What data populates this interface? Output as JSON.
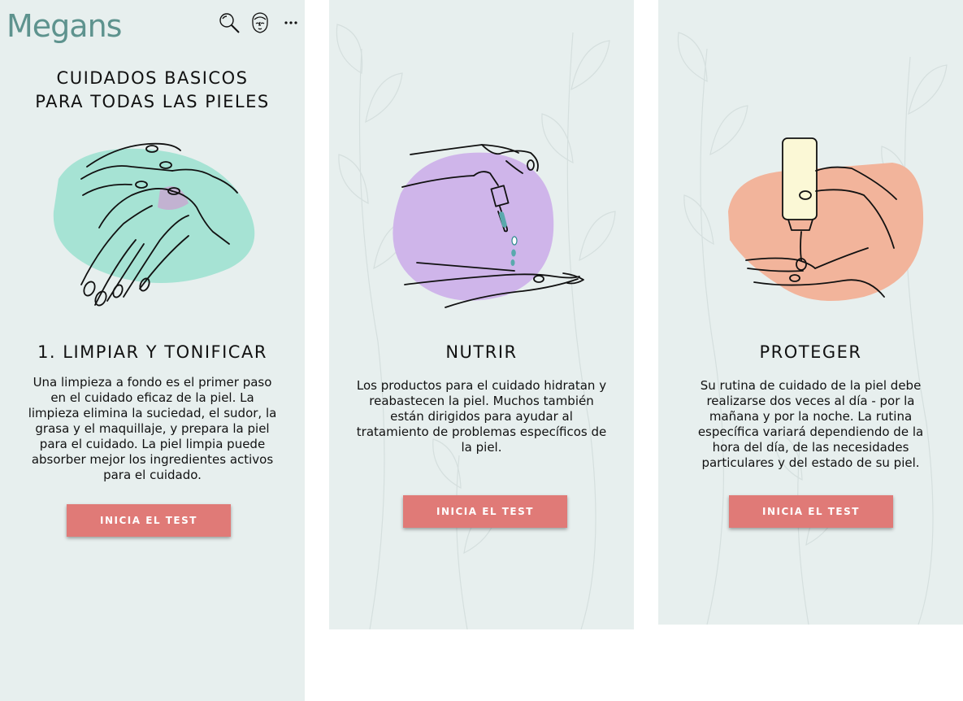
{
  "app": {
    "logo": "Megans",
    "icons": [
      "search-icon",
      "face-profile-icon",
      "more-icon"
    ],
    "colors": {
      "background": "#e7efee",
      "logo": "#5e938e",
      "button": "#e07a77",
      "blob_cleanse": "#a6e3d4",
      "blob_nourish": "#cfb5ea",
      "blob_protect": "#f2b49b"
    }
  },
  "cleanse": {
    "page_title": "CUIDADOS BASICOS\nPARA TODAS LAS PIELES",
    "title": "1. LIMPIAR Y TONIFICAR",
    "text": "Una limpieza a fondo es el primer paso en el cuidado eficaz de la piel. La limpieza elimina la suciedad, el sudor, la grasa y el maquillaje, y prepara la piel para el cuidado. La piel limpia puede absorber mejor los ingredientes activos  para el cuidado.",
    "button": "INICIA EL TEST"
  },
  "nourish": {
    "title": "NUTRIR",
    "text": "Los productos para el cuidado hidratan y reabastecen la piel. Muchos también están dirigidos para ayudar al tratamiento de problemas específicos de la piel.",
    "button": "INICIA EL TEST"
  },
  "protect": {
    "title": "PROTEGER",
    "text": "Su rutina de cuidado de la piel debe realizarse dos veces al día - por la mañana y por la noche. La rutina específica variará dependiendo de la hora del día, de las necesidades particulares y del estado de su piel.",
    "button": "INICIA EL TEST"
  }
}
